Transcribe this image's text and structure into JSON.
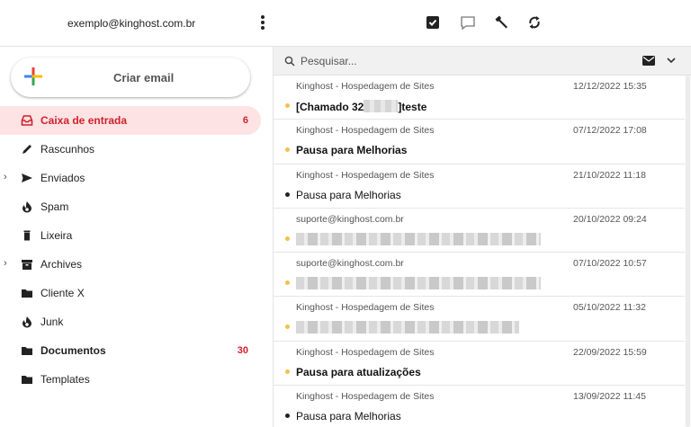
{
  "header": {
    "account": "exemplo@kinghost.com.br",
    "toolbar_icons": [
      "checkbox-icon",
      "chat-icon",
      "wrench-icon",
      "refresh-icon"
    ]
  },
  "compose": {
    "label": "Criar email"
  },
  "folders": [
    {
      "name": "Caixa de entrada",
      "icon": "inbox-icon",
      "count": "6",
      "active": true
    },
    {
      "name": "Rascunhos",
      "icon": "pencil-icon"
    },
    {
      "name": "Enviados",
      "icon": "send-icon",
      "expandable": true
    },
    {
      "name": "Spam",
      "icon": "fire-icon"
    },
    {
      "name": "Lixeira",
      "icon": "trash-icon"
    },
    {
      "name": "Archives",
      "icon": "archive-icon",
      "expandable": true
    },
    {
      "name": "Cliente X",
      "icon": "folder-icon"
    },
    {
      "name": "Junk",
      "icon": "fire-icon"
    },
    {
      "name": "Documentos",
      "icon": "folder-icon",
      "count": "30",
      "bold": true
    },
    {
      "name": "Templates",
      "icon": "folder-icon"
    }
  ],
  "search": {
    "placeholder": "Pesquisar..."
  },
  "messages": [
    {
      "from": "Kinghost - Hospedagem de Sites",
      "date": "12/12/2022 15:35",
      "subject_a": "[Chamado 32",
      "subject_b": "]teste",
      "unread": true
    },
    {
      "from": "Kinghost - Hospedagem de Sites",
      "date": "07/12/2022 17:08",
      "subject": "Pausa para Melhorias",
      "unread": true
    },
    {
      "from": "Kinghost - Hospedagem de Sites",
      "date": "21/10/2022 11:18",
      "subject": "Pausa para Melhorias",
      "unread": false
    },
    {
      "from": "suporte@kinghost.com.br",
      "date": "20/10/2022 09:24",
      "subject": "",
      "unread": true
    },
    {
      "from": "suporte@kinghost.com.br",
      "date": "07/10/2022 10:57",
      "subject": "",
      "unread": true
    },
    {
      "from": "Kinghost - Hospedagem de Sites",
      "date": "05/10/2022 11:32",
      "subject": "",
      "unread": true
    },
    {
      "from": "Kinghost - Hospedagem de Sites",
      "date": "22/09/2022 15:59",
      "subject": "Pausa para atualizações",
      "unread": true
    },
    {
      "from": "Kinghost - Hospedagem de Sites",
      "date": "13/09/2022 11:45",
      "subject": "Pausa para Melhorias",
      "unread": false
    }
  ],
  "colors": {
    "accent": "#d0212d",
    "active_bg": "#fde3e4",
    "unread_dot": "#f2c14e"
  }
}
